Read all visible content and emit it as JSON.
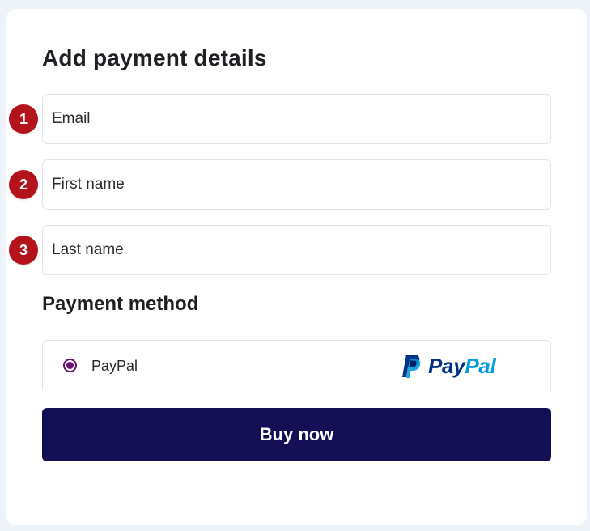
{
  "form": {
    "title": "Add payment details",
    "fields": [
      {
        "step": "1",
        "placeholder": "Email"
      },
      {
        "step": "2",
        "placeholder": "First name"
      },
      {
        "step": "3",
        "placeholder": "Last name"
      }
    ]
  },
  "payment": {
    "title": "Payment method",
    "method_label": "PayPal",
    "method_selected": true,
    "logo_text_pay": "Pay",
    "logo_text_pal": "Pal"
  },
  "actions": {
    "buy_label": "Buy now"
  },
  "colors": {
    "page_background": "#eef2f9",
    "badge": "#b3141c",
    "radio_accent": "#6b0f73",
    "button": "#140f55",
    "paypal_dark": "#003087",
    "paypal_light": "#009cde"
  },
  "icons": {
    "paypal_logo": "paypal-logo-icon",
    "radio": "radio-selected-icon"
  }
}
